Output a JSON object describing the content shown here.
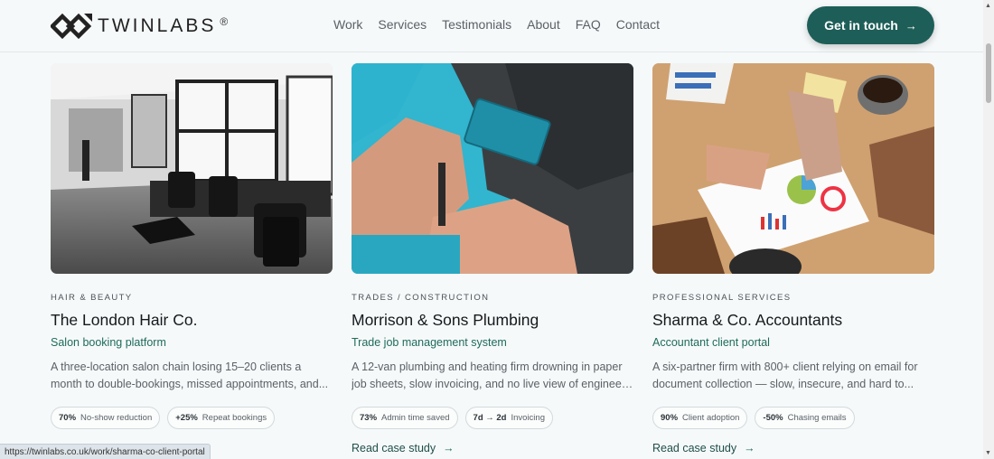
{
  "brand": {
    "name": "TWINLABS",
    "reg": "®"
  },
  "nav": [
    "Work",
    "Services",
    "Testimonials",
    "About",
    "FAQ",
    "Contact"
  ],
  "cta": {
    "label": "Get in touch",
    "icon": "arrow-right-icon"
  },
  "cards": [
    {
      "category": "HAIR & BEAUTY",
      "title": "The London Hair Co.",
      "subtitle": "Salon booking platform",
      "desc": [
        "A three-location salon chain losing 15–20 clients a",
        "month to double-bookings, missed appointments, and..."
      ],
      "badges": [
        {
          "value": "70%",
          "label": "No-show reduction"
        },
        {
          "value": "+25%",
          "label": "Repeat bookings"
        }
      ],
      "link": ""
    },
    {
      "category": "TRADES / CONSTRUCTION",
      "title": "Morrison & Sons Plumbing",
      "subtitle": "Trade job management system",
      "desc": [
        "A 12-van plumbing and heating firm drowning in paper",
        "job sheets, slow invoicing, and no live view of engineer..."
      ],
      "badges": [
        {
          "value": "73%",
          "label": "Admin time saved"
        },
        {
          "value": "7d → 2d",
          "label": "Invoicing"
        }
      ],
      "link": "Read case study"
    },
    {
      "category": "PROFESSIONAL SERVICES",
      "title": "Sharma & Co. Accountants",
      "subtitle": "Accountant client portal",
      "desc": [
        "A six-partner firm with 800+ client relying on email for",
        "document collection — slow, insecure, and hard to..."
      ],
      "badges": [
        {
          "value": "90%",
          "label": "Client adoption"
        },
        {
          "value": "-50%",
          "label": "Chasing emails"
        }
      ],
      "link": "Read case study"
    }
  ],
  "status_url": "https://twinlabs.co.uk/work/sharma-co-client-portal",
  "colors": {
    "brand": "#1e5e58",
    "accent": "#1e6b5a"
  }
}
